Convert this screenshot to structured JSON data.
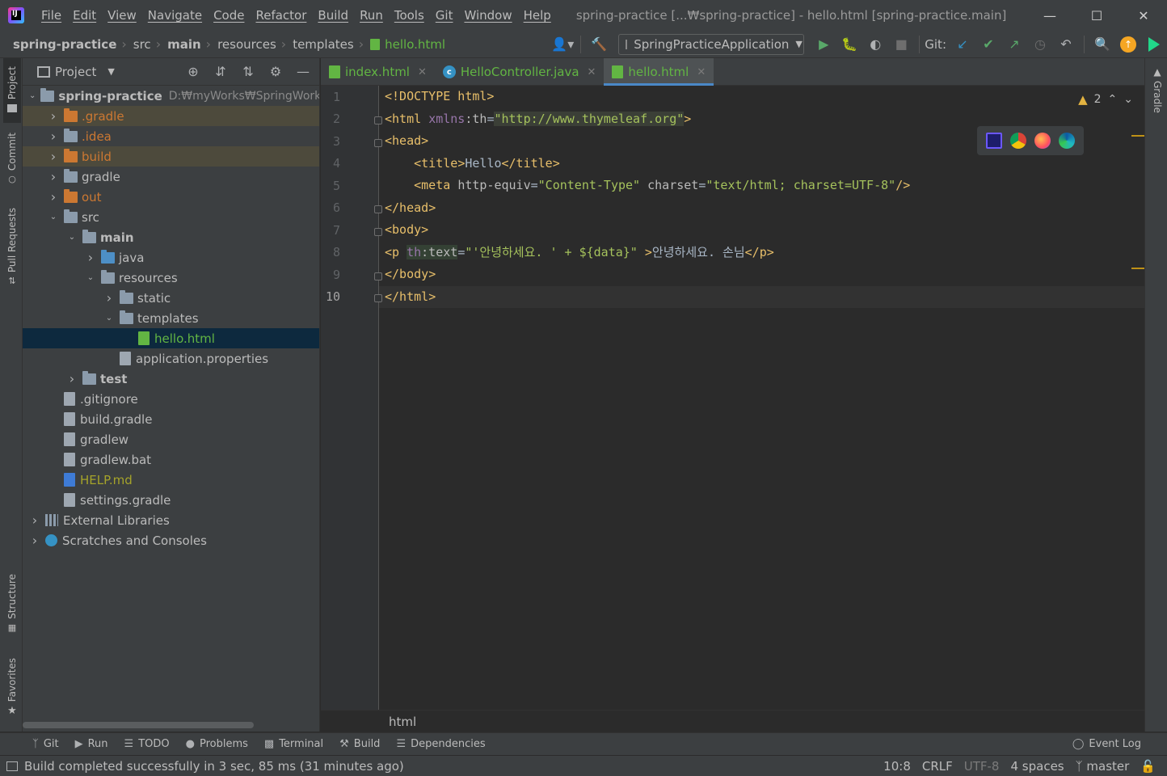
{
  "menu": [
    "File",
    "Edit",
    "View",
    "Navigate",
    "Code",
    "Refactor",
    "Build",
    "Run",
    "Tools",
    "Git",
    "Window",
    "Help"
  ],
  "window_title": "spring-practice [...₩spring-practice] - hello.html [spring-practice.main]",
  "breadcrumbs": [
    "spring-practice",
    "src",
    "main",
    "resources",
    "templates",
    "hello.html"
  ],
  "run_config": "SpringPracticeApplication",
  "git_label": "Git:",
  "left_tabs": [
    "Project",
    "Commit",
    "Pull Requests",
    "Structure",
    "Favorites"
  ],
  "right_tabs": [
    "Gradle"
  ],
  "project_panel": {
    "title": "Project",
    "tree": [
      {
        "label": "spring-practice",
        "path": "D:₩myWorks₩SpringWorks₩s",
        "depth": 0,
        "expanded": true,
        "kind": "module",
        "style": "bold"
      },
      {
        "label": ".gradle",
        "depth": 1,
        "expanded": false,
        "kind": "folder-orange",
        "style": "orange",
        "excluded": true
      },
      {
        "label": ".idea",
        "depth": 1,
        "expanded": false,
        "kind": "folder",
        "style": "orange"
      },
      {
        "label": "build",
        "depth": 1,
        "expanded": false,
        "kind": "folder-orange",
        "style": "orange",
        "excluded": true
      },
      {
        "label": "gradle",
        "depth": 1,
        "expanded": false,
        "kind": "folder",
        "style": ""
      },
      {
        "label": "out",
        "depth": 1,
        "expanded": false,
        "kind": "folder-orange",
        "style": "orange"
      },
      {
        "label": "src",
        "depth": 1,
        "expanded": true,
        "kind": "folder",
        "style": ""
      },
      {
        "label": "main",
        "depth": 2,
        "expanded": true,
        "kind": "folder",
        "style": "bold"
      },
      {
        "label": "java",
        "depth": 3,
        "expanded": false,
        "kind": "folder-blue",
        "style": ""
      },
      {
        "label": "resources",
        "depth": 3,
        "expanded": true,
        "kind": "folder",
        "style": ""
      },
      {
        "label": "static",
        "depth": 4,
        "expanded": false,
        "kind": "folder",
        "style": ""
      },
      {
        "label": "templates",
        "depth": 4,
        "expanded": true,
        "kind": "folder",
        "style": ""
      },
      {
        "label": "hello.html",
        "depth": 5,
        "kind": "file-html",
        "style": "green",
        "selected": true
      },
      {
        "label": "application.properties",
        "depth": 4,
        "kind": "file",
        "style": ""
      },
      {
        "label": "test",
        "depth": 2,
        "expanded": false,
        "kind": "folder",
        "style": "bold"
      },
      {
        "label": ".gitignore",
        "depth": 1,
        "kind": "file",
        "style": ""
      },
      {
        "label": "build.gradle",
        "depth": 1,
        "kind": "file",
        "style": ""
      },
      {
        "label": "gradlew",
        "depth": 1,
        "kind": "file",
        "style": ""
      },
      {
        "label": "gradlew.bat",
        "depth": 1,
        "kind": "file",
        "style": ""
      },
      {
        "label": "HELP.md",
        "depth": 1,
        "kind": "file-md",
        "style": "yellow"
      },
      {
        "label": "settings.gradle",
        "depth": 1,
        "kind": "file",
        "style": ""
      },
      {
        "label": "External Libraries",
        "depth": 0,
        "expanded": false,
        "kind": "lib",
        "style": ""
      },
      {
        "label": "Scratches and Consoles",
        "depth": 0,
        "expanded": false,
        "kind": "scratch",
        "style": ""
      }
    ]
  },
  "editor_tabs": [
    {
      "label": "index.html",
      "icon": "html-icon",
      "active": false
    },
    {
      "label": "HelloController.java",
      "icon": "class-icon",
      "active": false
    },
    {
      "label": "hello.html",
      "icon": "html-icon",
      "active": true
    }
  ],
  "editor": {
    "line_numbers": [
      "1",
      "2",
      "3",
      "4",
      "5",
      "6",
      "7",
      "8",
      "9",
      "10"
    ],
    "warning_count": "2",
    "breadcrumb": "html",
    "lines": [
      "<!DOCTYPE html>",
      "<html xmlns:th=\"http://www.thymeleaf.org\">",
      "<head>",
      "    <title>Hello</title>",
      "    <meta http-equiv=\"Content-Type\" charset=\"text/html; charset=UTF-8\"/>",
      "</head>",
      "<body>",
      "<p th:text=\"'안녕하세요. ' + ${data}\" >안녕하세요. 손님</p>",
      "</body>",
      "</html>"
    ]
  },
  "tool_windows": [
    "Git",
    "Run",
    "TODO",
    "Problems",
    "Terminal",
    "Build",
    "Dependencies"
  ],
  "event_log": "Event Log",
  "status": {
    "message": "Build completed successfully in 3 sec, 85 ms (31 minutes ago)",
    "position": "10:8",
    "line_sep": "CRLF",
    "encoding": "UTF-8",
    "indent": "4 spaces",
    "branch": "master"
  },
  "colors": {
    "accent": "#4a88c7",
    "html_file": "#62b543",
    "excluded": "#cc7832",
    "tag": "#e8bf6a",
    "string": "#a5c25c"
  }
}
